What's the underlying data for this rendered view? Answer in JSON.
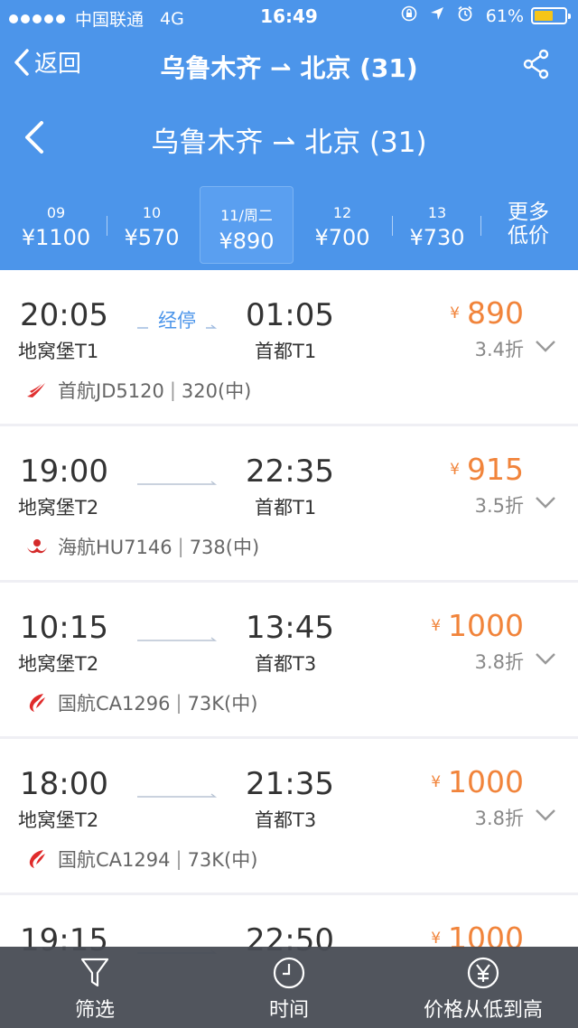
{
  "status_bar": {
    "carrier": "中国联通",
    "network": "4G",
    "time": "16:49",
    "battery": "61%",
    "battery_level": 0.61
  },
  "nav": {
    "back_label": "返回",
    "title": "乌鲁木齐 ⇀ 北京 (31)"
  },
  "sub_header": {
    "title": "乌鲁木齐 ⇀ 北京 (31)"
  },
  "dates": [
    {
      "day": "09",
      "price": "¥1100"
    },
    {
      "day": "10",
      "price": "¥570"
    },
    {
      "day": "11/周二",
      "price": "¥890"
    },
    {
      "day": "12",
      "price": "¥700"
    },
    {
      "day": "13",
      "price": "¥730"
    }
  ],
  "more_low": {
    "line1": "更多",
    "line2": "低价"
  },
  "flights": [
    {
      "dep_time": "20:05",
      "dep_airport": "地窝堡T1",
      "stop": "经停",
      "arr_time": "01:05",
      "arr_airport": "首都T1",
      "price": "890",
      "yen": "¥",
      "discount": "3.4折",
      "airline": "首航JD5120",
      "aircraft": "320(中)",
      "accent": "#f1843b"
    },
    {
      "dep_time": "19:00",
      "dep_airport": "地窝堡T2",
      "stop": "",
      "arr_time": "22:35",
      "arr_airport": "首都T1",
      "price": "915",
      "yen": "¥",
      "discount": "3.5折",
      "airline": "海航HU7146",
      "aircraft": "738(中)",
      "accent": "#f1843b"
    },
    {
      "dep_time": "10:15",
      "dep_airport": "地窝堡T2",
      "stop": "",
      "arr_time": "13:45",
      "arr_airport": "首都T3",
      "price": "1000",
      "yen": "¥",
      "discount": "3.8折",
      "airline": "国航CA1296",
      "aircraft": "73K(中)",
      "accent": "#f1843b"
    },
    {
      "dep_time": "18:00",
      "dep_airport": "地窝堡T2",
      "stop": "",
      "arr_time": "21:35",
      "arr_airport": "首都T3",
      "price": "1000",
      "yen": "¥",
      "discount": "3.8折",
      "airline": "国航CA1294",
      "aircraft": "73K(中)",
      "accent": "#f1843b"
    },
    {
      "dep_time": "19:15",
      "dep_airport": "",
      "stop": "",
      "arr_time": "22:50",
      "arr_airport": "",
      "price": "1000",
      "yen": "¥",
      "discount": "",
      "airline": "",
      "aircraft": "",
      "accent": "#f1843b"
    }
  ],
  "tabbar": {
    "filter": "筛选",
    "time": "时间",
    "price_sort": "价格从低到高"
  },
  "colors": {
    "header_blue": "#4c95ea",
    "price_orange": "#f1843b"
  }
}
